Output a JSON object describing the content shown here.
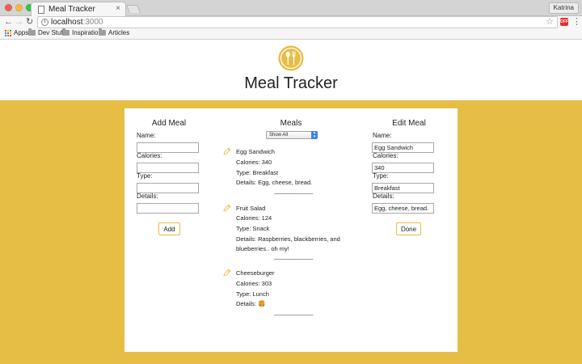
{
  "browser": {
    "tab_title": "Meal Tracker",
    "tab_close": "×",
    "profile_name": "Katrina",
    "url_host": "localhost",
    "url_port": ":3000",
    "ext_badge": "OFF",
    "bookmarks": [
      "Apps",
      "Dev Stuff",
      "Inspiration",
      "Articles"
    ]
  },
  "header": {
    "title": "Meal Tracker",
    "logo_icon": "fork-spoon-icon"
  },
  "colors": {
    "accent": "#e6bd45",
    "button_border": "#e6bd45"
  },
  "add_meal": {
    "heading": "Add Meal",
    "name_label": "Name:",
    "name_value": "",
    "calories_label": "Calories:",
    "calories_value": "",
    "type_label": "Type:",
    "type_value": "",
    "details_label": "Details:",
    "details_value": "",
    "add_button": "Add"
  },
  "meals": {
    "heading": "Meals",
    "filter_selected": "Show All",
    "separator": "--------------------------------",
    "items": [
      {
        "name": "Egg Sandwich",
        "calories": "Calories: 340",
        "type": "Type: Breakfast",
        "details": [
          "Details: Egg, cheese, bread."
        ]
      },
      {
        "name": "Fruit Salad",
        "calories": "Calories: 124",
        "type": "Type: Snack",
        "details": [
          "Details: Raspberries, blackberries, and",
          "blueberries.. oh my!"
        ]
      },
      {
        "name": "Cheeseburger",
        "calories": "Calories: 303",
        "type": "Type: Lunch",
        "details": [
          "Details: 🍔"
        ]
      }
    ]
  },
  "edit_meal": {
    "heading": "Edit Meal",
    "name_label": "Name:",
    "name_value": "Egg Sandwich",
    "calories_label": "Calories:",
    "calories_value": "340",
    "type_label": "Type:",
    "type_value": "Breakfast",
    "details_label": "Details:",
    "details_value": "Egg, cheese, bread.",
    "done_button": "Done"
  }
}
